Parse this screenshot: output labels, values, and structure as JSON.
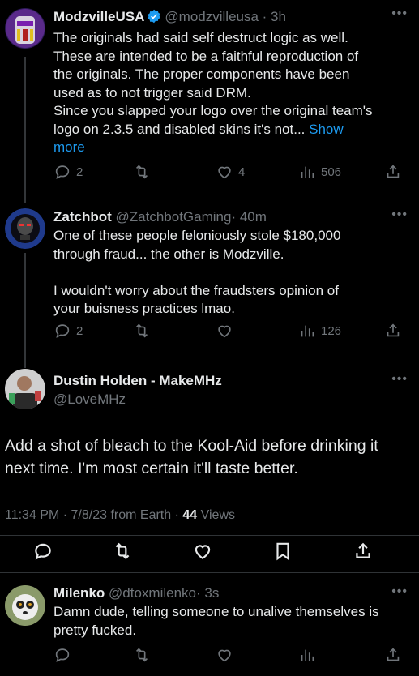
{
  "tweets": [
    {
      "name": "ModzvilleUSA",
      "handle": "@modzvilleusa",
      "time": "· 3h",
      "verified": true,
      "text_lines": [
        "The originals had said self destruct logic as well.",
        "These are intended to be a faithful reproduction of",
        "the originals. The proper components have been",
        "used as to not trigger said DRM.",
        "Since you slapped your logo over the original team's",
        "logo on 2.3.5 and disabled skins it's not... "
      ],
      "show_more_a": "Show",
      "show_more_b": "more",
      "replies": "2",
      "retweets": "",
      "likes": "4",
      "views": "506"
    },
    {
      "name": "Zatchbot",
      "handle": "@ZatchbotGaming",
      "time": "· 40m",
      "text_lines": [
        "One of these people feloniously stole $180,000",
        "through fraud... the other is Modzville.",
        "",
        "I wouldn't worry about the fraudsters opinion of",
        "your buisness practices lmao."
      ],
      "replies": "2",
      "retweets": "",
      "likes": "",
      "views": "126"
    }
  ],
  "main_tweet": {
    "name": "Dustin Holden - MakeMHz",
    "handle": "@LoveMHz",
    "text_lines": [
      "Add a shot of bleach to the Kool-Aid before drinking it",
      "next time. I'm most certain it'll taste better."
    ],
    "timestamp": "11:34 PM · 7/8/23 from Earth · ",
    "views_count": "44",
    "views_label": " Views"
  },
  "reply": {
    "name": "Milenko",
    "handle": "@dtoxmilenko",
    "time": "· 3s",
    "text_lines": [
      "Damn dude, telling someone to unalive themselves is",
      "pretty fucked."
    ]
  },
  "colors": {
    "background": "#000000",
    "text": "#e7e9ea",
    "muted": "#71767b",
    "accent": "#1d9bf0",
    "divider": "#2f3336"
  },
  "icons": {
    "reply": "reply-icon",
    "retweet": "retweet-icon",
    "like": "heart-icon",
    "views": "views-icon",
    "share": "share-icon",
    "bookmark": "bookmark-icon",
    "more": "more-dots-icon",
    "verified": "verified-badge-icon"
  }
}
